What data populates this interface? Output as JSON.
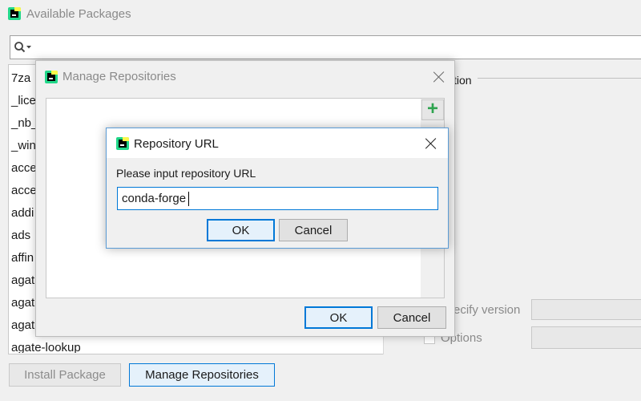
{
  "main_window": {
    "title": "Available Packages",
    "search_placeholder": "",
    "packages": [
      "7za",
      "_lice",
      "_nb_",
      "_win",
      "acce",
      "acce",
      "addi",
      "ads",
      "affin",
      "agat",
      "agat",
      "agat",
      "agate-lookup"
    ],
    "description_label": "tion",
    "specify_version_label": "ecify version",
    "options_label": "Options",
    "install_button": "Install Package",
    "manage_repos_button": "Manage Repositories"
  },
  "manage_repositories": {
    "title": "Manage Repositories",
    "add_symbol": "+",
    "ok_button": "OK",
    "cancel_button": "Cancel"
  },
  "repository_url_dialog": {
    "title": "Repository URL",
    "prompt": "Please input repository URL",
    "url_value": "conda-forge",
    "ok_button": "OK",
    "cancel_button": "Cancel"
  },
  "colors": {
    "accent": "#0078d7",
    "add_green": "#2ea44f",
    "brand_green": "#21d789",
    "brand_yellow": "#fcf84a"
  }
}
